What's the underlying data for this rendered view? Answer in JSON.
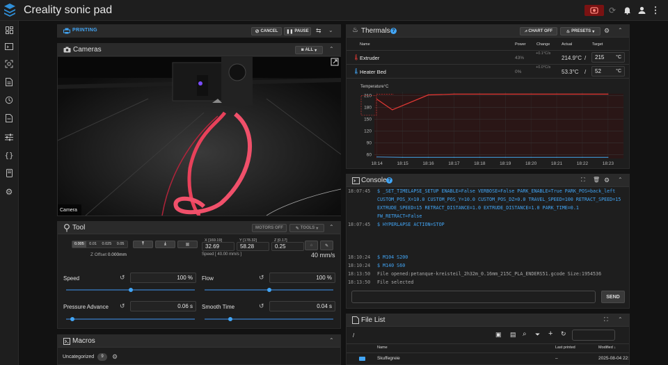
{
  "app": {
    "title": "Creality sonic pad"
  },
  "status": {
    "state": "PRINTING",
    "cancel": "CANCEL",
    "pause": "PAUSE"
  },
  "cameras": {
    "title": "Cameras",
    "all": "ALL",
    "caption": "Camera"
  },
  "tool": {
    "title": "Tool",
    "motors_off": "MOTORS OFF",
    "tools": "TOOLS",
    "steps": [
      "0.005",
      "0.01",
      "0.025",
      "0.05"
    ],
    "z_offset_label": "Z Offset",
    "z_offset_value": "0.000mm",
    "x_label": "X",
    "x_max": "[169.19]",
    "x_value": "32.69",
    "y_label": "Y",
    "y_max": "[178.32]",
    "y_value": "58.28",
    "z_label": "Z",
    "z_max": "[0.17]",
    "z_value": "0.25",
    "speed_note": "Speed [ 40.00 mm/s ]",
    "speed_readout": "40 mm/s",
    "speed_label": "Speed",
    "speed_value": "100 %",
    "speed_fraction": 0.5,
    "flow_label": "Flow",
    "flow_value": "100 %",
    "flow_fraction": 0.5,
    "pa_label": "Pressure Advance",
    "pa_value": "0.06 s",
    "pa_fraction": 0.05,
    "st_label": "Smooth Time",
    "st_value": "0.04 s",
    "st_fraction": 0.2
  },
  "macros": {
    "title": "Macros",
    "group": "Uncategorized",
    "count": "9"
  },
  "thermals": {
    "title": "Thermals",
    "chart_off": "CHART OFF",
    "presets": "PRESETS",
    "cols": {
      "name": "Name",
      "power": "Power",
      "change": "Change",
      "actual": "Actual",
      "target": "Target"
    },
    "rows": [
      {
        "name": "Extruder",
        "power": "43%",
        "change": "+0.1°C/s",
        "actual": "214.9°C",
        "sep": "/",
        "target": "215",
        "unit": "°C",
        "color": "#e53935"
      },
      {
        "name": "Heater Bed",
        "power": "0%",
        "change": "+0.0°C/s",
        "actual": "53.3°C",
        "sep": "/",
        "target": "52",
        "unit": "°C",
        "color": "#42a5f5"
      }
    ]
  },
  "chart_data": {
    "type": "line",
    "title": "Temperature°C",
    "x": [
      "18:14",
      "18:15",
      "18:16",
      "18:17",
      "18:18",
      "18:19",
      "18:20",
      "18:21",
      "18:22",
      "18:23"
    ],
    "yticks": [
      60,
      90,
      120,
      150,
      180,
      210
    ],
    "ylim": [
      50,
      220
    ],
    "grid": true,
    "series": [
      {
        "color": "#e53935",
        "values": [
          201,
          174,
          212,
          214,
          214,
          214,
          214,
          214,
          214,
          214
        ]
      },
      {
        "color": "#3b9ad9",
        "values": [
          54,
          53,
          53,
          53,
          53,
          53,
          53,
          53,
          53,
          53
        ]
      }
    ]
  },
  "console": {
    "title": "Console",
    "send": "SEND",
    "lines": [
      {
        "time": "18:07:45",
        "text": "$ _SET_TIMELAPSE_SETUP ENABLE=False VERBOSE=False PARK_ENABLE=True PARK_POS=back_left",
        "cmd": true
      },
      {
        "time": "",
        "text": "CUSTOM_POS_X=10.0 CUSTOM_POS_Y=10.0 CUSTOM_POS_DZ=0.0 TRAVEL_SPEED=100 RETRACT_SPEED=15",
        "cmd": true
      },
      {
        "time": "",
        "text": "EXTRUDE_SPEED=15 RETRACT_DISTANCE=1.0 EXTRUDE_DISTANCE=1.0 PARK_TIME=0.1",
        "cmd": true
      },
      {
        "time": "",
        "text": "FW_RETRACT=False",
        "cmd": true
      },
      {
        "time": "18:07:45",
        "text": "$ HYPERLAPSE ACTION=STOP",
        "cmd": true
      },
      {
        "time": "",
        "text": "",
        "cmd": false
      },
      {
        "time": "",
        "text": "",
        "cmd": false
      },
      {
        "time": "",
        "text": "",
        "cmd": false
      },
      {
        "time": "18:10:24",
        "text": "$ M104 S200",
        "cmd": true
      },
      {
        "time": "18:10:24",
        "text": "$ M140 S60",
        "cmd": true
      },
      {
        "time": "18:13:50",
        "text": "File opened:petanque-kreisteil_2h32m_0.16mm_215C_PLA_ENDERS51.gcode Size:1954536",
        "cmd": false
      },
      {
        "time": "18:13:50",
        "text": "File selected",
        "cmd": false
      },
      {
        "time": "18:14:21",
        "text": "// Filament Sensor filament sensor: filament detected",
        "cmd": false
      }
    ]
  },
  "filelist": {
    "title": "File List",
    "path": "/",
    "cols": {
      "name": "Name",
      "last_printed": "Last printed",
      "modified": "Modified"
    },
    "rows": [
      {
        "name": "Skuffegreie",
        "last_printed": "–",
        "modified": "2025-08-04 22:"
      }
    ]
  }
}
